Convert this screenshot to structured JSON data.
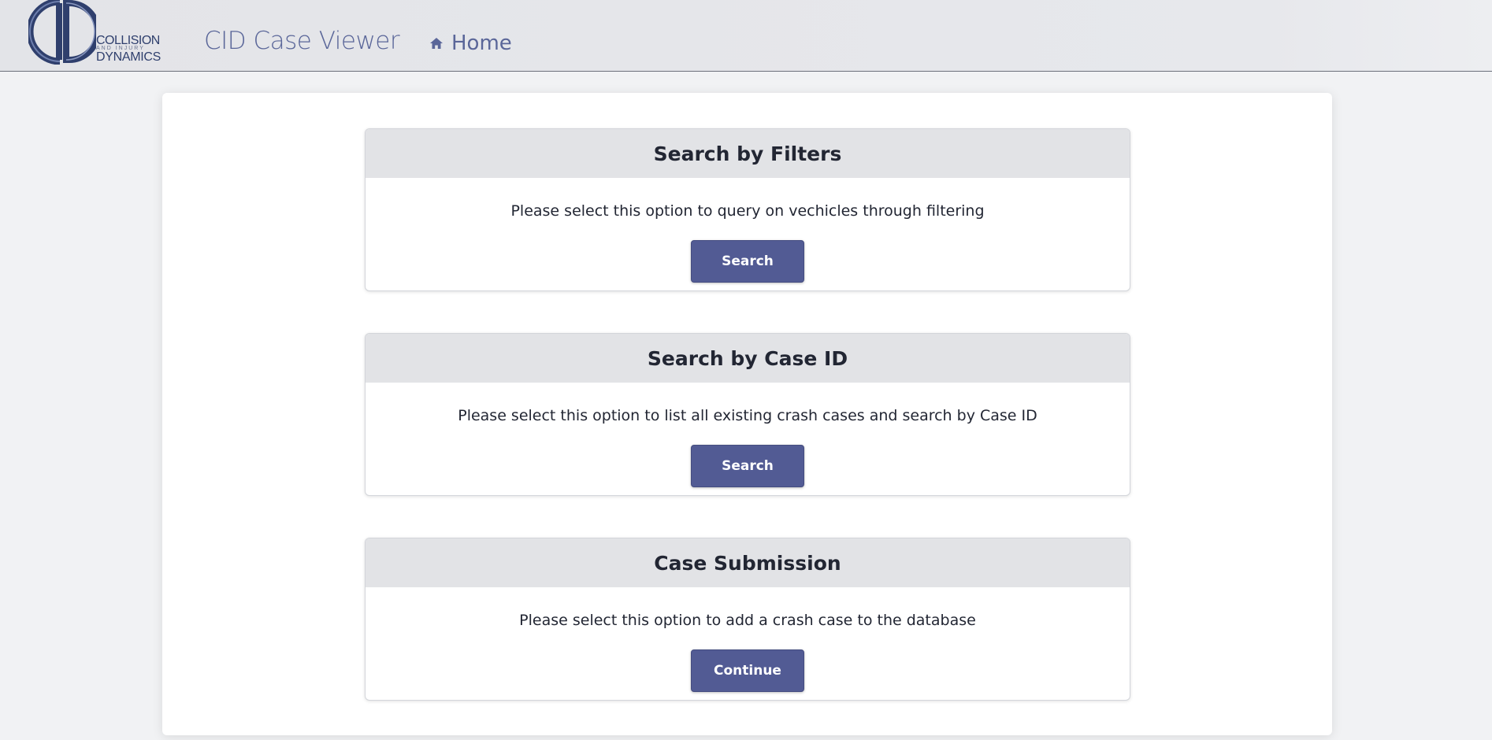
{
  "header": {
    "logo": {
      "line1": "COLLISION",
      "line2": "AND INJURY",
      "line3": "DYNAMICS"
    },
    "app_title": "CID Case Viewer",
    "nav": {
      "home_label": "Home",
      "home_icon": "home-icon"
    }
  },
  "options": [
    {
      "title": "Search by Filters",
      "description": "Please select this option to query on vechicles through filtering",
      "button_label": "Search"
    },
    {
      "title": "Search by Case ID",
      "description": "Please select this option to list all existing crash cases and search by Case ID",
      "button_label": "Search"
    },
    {
      "title": "Case Submission",
      "description": "Please select this option to add a crash case to the database",
      "button_label": "Continue"
    }
  ],
  "colors": {
    "accent": "#525b94",
    "brand": "#2f3f6d",
    "nav_text": "#5a6699",
    "card_header_bg": "#e2e3e6"
  }
}
